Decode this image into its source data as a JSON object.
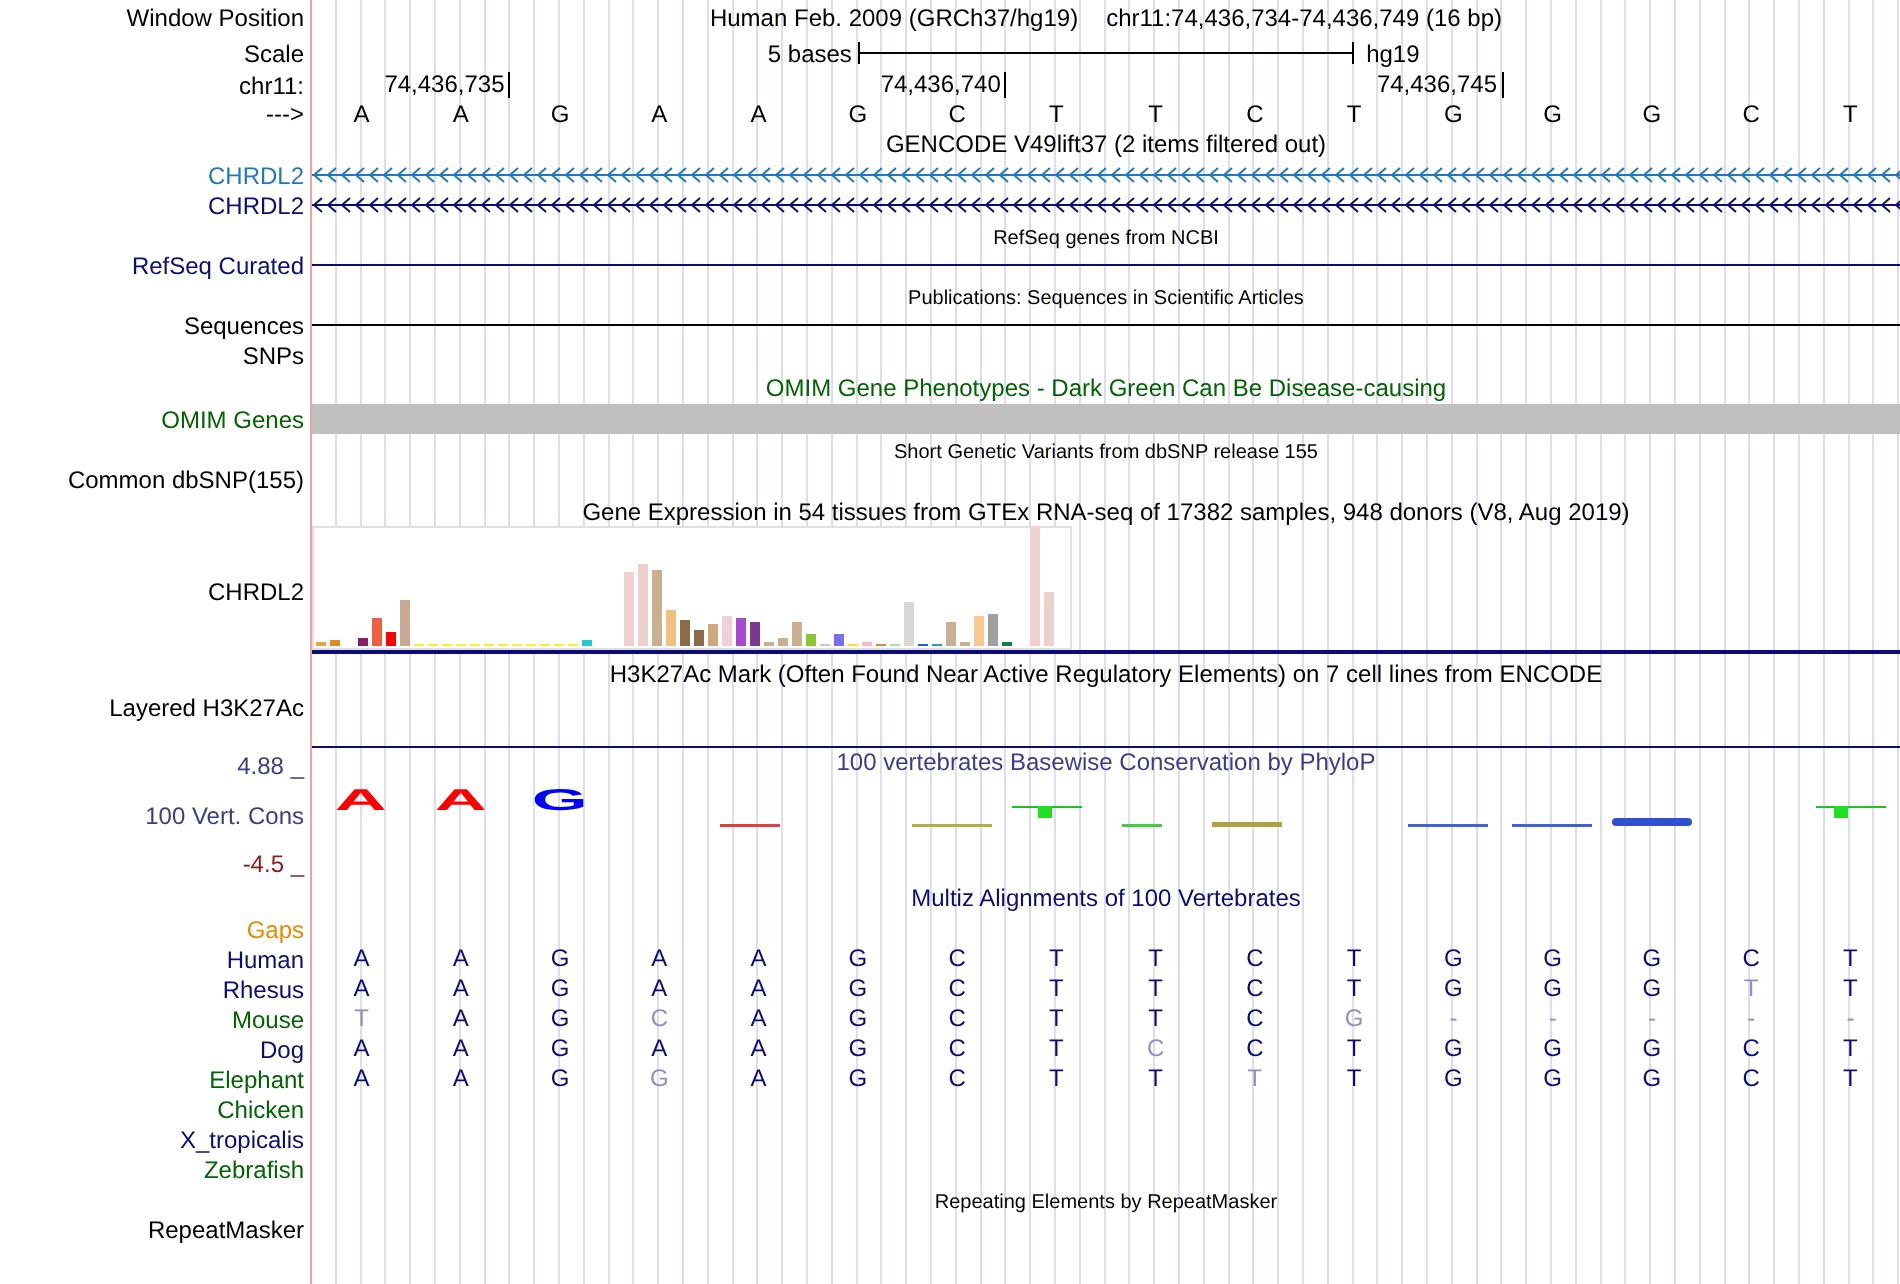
{
  "position": {
    "label": "Window Position",
    "assembly": "Human Feb. 2009 (GRCh37/hg19)",
    "region": "chr11:74,436,734-74,436,749 (16 bp)"
  },
  "scale": {
    "label": "Scale",
    "bar_label": "5 bases",
    "assembly": "hg19"
  },
  "ruler": {
    "label": "chr11:",
    "ticks": [
      "74,436,735",
      "74,436,740",
      "74,436,745"
    ]
  },
  "bases": {
    "label": "--->",
    "letters": [
      "A",
      "A",
      "G",
      "A",
      "A",
      "G",
      "C",
      "T",
      "T",
      "C",
      "T",
      "G",
      "G",
      "G",
      "C",
      "T"
    ]
  },
  "tracks": [
    {
      "kind": "genes",
      "title": "GENCODE V49lift37 (2 items filtered out)",
      "items": [
        {
          "name": "CHRDL2",
          "color": "#1f78c0"
        },
        {
          "name": "CHRDL2",
          "color": "#0c0c78"
        }
      ]
    },
    {
      "kind": "line",
      "title": "RefSeq genes from NCBI",
      "label": "RefSeq Curated",
      "color": "#0c0c78"
    },
    {
      "kind": "line",
      "title": "Publications: Sequences in Scientific Articles",
      "label": "Sequences",
      "color": "#000000"
    },
    {
      "kind": "empty",
      "label": "SNPs"
    },
    {
      "kind": "bar",
      "title": "OMIM Gene Phenotypes - Dark Green Can Be Disease-causing",
      "label": "OMIM Genes",
      "color": "#006400"
    },
    {
      "kind": "empty",
      "title": "Short Genetic Variants from dbSNP release 155",
      "label": "Common dbSNP(155)"
    },
    {
      "kind": "expression",
      "title": "Gene Expression in 54 tissues from GTEx RNA-seq of 17382 samples, 948 donors (V8, Aug 2019)",
      "label": "CHRDL2"
    },
    {
      "kind": "layered",
      "title": "H3K27Ac Mark (Often Found Near Active Regulatory Elements) on 7 cell lines from ENCODE",
      "label": "Layered H3K27Ac"
    },
    {
      "kind": "conservation",
      "title": "100 vertebrates Basewise Conservation by PhyloP",
      "label": "100 Vert. Cons",
      "ymax": "4.88 _",
      "ymin": "-4.5 _",
      "logo": [
        {
          "base": "A",
          "color": "#ff0000"
        },
        {
          "base": "A",
          "color": "#ff0000"
        },
        {
          "base": "G",
          "color": "#0000ff"
        }
      ]
    },
    {
      "kind": "alignment",
      "title": "Multiz Alignments of 100 Vertebrates",
      "gaps": "Gaps",
      "species": [
        {
          "name": "Human",
          "color": "#0c0c78",
          "bases": [
            {
              "b": "A",
              "dim": false
            },
            {
              "b": "A",
              "dim": false
            },
            {
              "b": "G",
              "dim": false
            },
            {
              "b": "A",
              "dim": false
            },
            {
              "b": "A",
              "dim": false
            },
            {
              "b": "G",
              "dim": false
            },
            {
              "b": "C",
              "dim": false
            },
            {
              "b": "T",
              "dim": false
            },
            {
              "b": "T",
              "dim": false
            },
            {
              "b": "C",
              "dim": false
            },
            {
              "b": "T",
              "dim": false
            },
            {
              "b": "G",
              "dim": false
            },
            {
              "b": "G",
              "dim": false
            },
            {
              "b": "G",
              "dim": false
            },
            {
              "b": "C",
              "dim": false
            },
            {
              "b": "T",
              "dim": false
            }
          ]
        },
        {
          "name": "Rhesus",
          "color": "#0c0c78",
          "bases": [
            {
              "b": "A",
              "dim": false
            },
            {
              "b": "A",
              "dim": false
            },
            {
              "b": "G",
              "dim": false
            },
            {
              "b": "A",
              "dim": false
            },
            {
              "b": "A",
              "dim": false
            },
            {
              "b": "G",
              "dim": false
            },
            {
              "b": "C",
              "dim": false
            },
            {
              "b": "T",
              "dim": false
            },
            {
              "b": "T",
              "dim": false
            },
            {
              "b": "C",
              "dim": false
            },
            {
              "b": "T",
              "dim": false
            },
            {
              "b": "G",
              "dim": false
            },
            {
              "b": "G",
              "dim": false
            },
            {
              "b": "G",
              "dim": false
            },
            {
              "b": "T",
              "dim": true
            },
            {
              "b": "T",
              "dim": false
            }
          ]
        },
        {
          "name": "Mouse",
          "color": "#006400",
          "bases": [
            {
              "b": "T",
              "dim": true
            },
            {
              "b": "A",
              "dim": false
            },
            {
              "b": "G",
              "dim": false
            },
            {
              "b": "C",
              "dim": true
            },
            {
              "b": "A",
              "dim": false
            },
            {
              "b": "G",
              "dim": false
            },
            {
              "b": "C",
              "dim": false
            },
            {
              "b": "T",
              "dim": false
            },
            {
              "b": "T",
              "dim": false
            },
            {
              "b": "C",
              "dim": false
            },
            {
              "b": "G",
              "dim": true
            },
            {
              "b": "-",
              "dim": true
            },
            {
              "b": "-",
              "dim": true
            },
            {
              "b": "-",
              "dim": true
            },
            {
              "b": "-",
              "dim": true
            },
            {
              "b": "-",
              "dim": true
            }
          ]
        },
        {
          "name": "Dog",
          "color": "#0c0c78",
          "bases": [
            {
              "b": "A",
              "dim": false
            },
            {
              "b": "A",
              "dim": false
            },
            {
              "b": "G",
              "dim": false
            },
            {
              "b": "A",
              "dim": false
            },
            {
              "b": "A",
              "dim": false
            },
            {
              "b": "G",
              "dim": false
            },
            {
              "b": "C",
              "dim": false
            },
            {
              "b": "T",
              "dim": false
            },
            {
              "b": "C",
              "dim": true
            },
            {
              "b": "C",
              "dim": false
            },
            {
              "b": "T",
              "dim": false
            },
            {
              "b": "G",
              "dim": false
            },
            {
              "b": "G",
              "dim": false
            },
            {
              "b": "G",
              "dim": false
            },
            {
              "b": "C",
              "dim": false
            },
            {
              "b": "T",
              "dim": false
            }
          ]
        },
        {
          "name": "Elephant",
          "color": "#006400",
          "bases": [
            {
              "b": "A",
              "dim": false
            },
            {
              "b": "A",
              "dim": false
            },
            {
              "b": "G",
              "dim": false
            },
            {
              "b": "G",
              "dim": true
            },
            {
              "b": "A",
              "dim": false
            },
            {
              "b": "G",
              "dim": false
            },
            {
              "b": "C",
              "dim": false
            },
            {
              "b": "T",
              "dim": false
            },
            {
              "b": "T",
              "dim": false
            },
            {
              "b": "T",
              "dim": true
            },
            {
              "b": "T",
              "dim": false
            },
            {
              "b": "G",
              "dim": false
            },
            {
              "b": "G",
              "dim": false
            },
            {
              "b": "G",
              "dim": false
            },
            {
              "b": "C",
              "dim": false
            },
            {
              "b": "T",
              "dim": false
            }
          ]
        },
        {
          "name": "Chicken",
          "color": "#006400"
        },
        {
          "name": "X_tropicalis",
          "color": "#0c0c78"
        },
        {
          "name": "Zebrafish",
          "color": "#006400"
        }
      ]
    },
    {
      "kind": "empty",
      "title": "Repeating Elements by RepeatMasker",
      "label": "RepeatMasker"
    }
  ]
}
